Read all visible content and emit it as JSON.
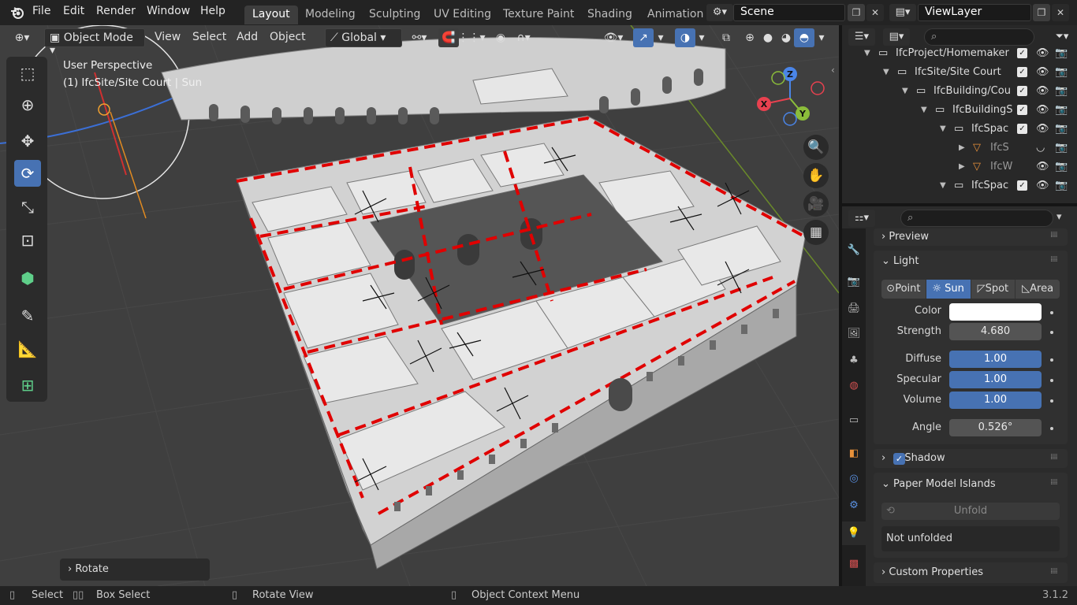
{
  "menubar": {
    "items": [
      "File",
      "Edit",
      "Render",
      "Window",
      "Help"
    ],
    "workspaces": [
      "Layout",
      "Modeling",
      "Sculpting",
      "UV Editing",
      "Texture Paint",
      "Shading",
      "Animation"
    ],
    "active_workspace": "Layout",
    "scene": "Scene",
    "view_layer": "ViewLayer"
  },
  "viewport_header": {
    "mode": "Object Mode",
    "menus": [
      "View",
      "Select",
      "Add",
      "Object"
    ],
    "orientation": "Global"
  },
  "viewport": {
    "perspective_label": "User Perspective",
    "object_label": "(1) IfcSite/Site Court | Sun",
    "last_operator": "Rotate",
    "gizmo_axes": [
      "X",
      "Y",
      "Z"
    ]
  },
  "outliner": {
    "rows": [
      {
        "label": "IfcProject/Homemaker",
        "indent": 0
      },
      {
        "label": "IfcSite/Site Court",
        "indent": 1
      },
      {
        "label": "IfcBuilding/Cou",
        "indent": 2
      },
      {
        "label": "IfcBuildingS",
        "indent": 3
      },
      {
        "label": "IfcSpac",
        "indent": 4
      },
      {
        "label": "IfcS",
        "indent": 5
      },
      {
        "label": "IfcW",
        "indent": 5
      },
      {
        "label": "IfcSpac",
        "indent": 4
      }
    ]
  },
  "properties": {
    "preview_label": "Preview",
    "light_label": "Light",
    "light_types": [
      "Point",
      "Sun",
      "Spot",
      "Area"
    ],
    "active_light_type": "Sun",
    "color_label": "Color",
    "strength_label": "Strength",
    "strength": "4.680",
    "diffuse_label": "Diffuse",
    "diffuse": "1.00",
    "specular_label": "Specular",
    "specular": "1.00",
    "volume_label": "Volume",
    "volume": "1.00",
    "angle_label": "Angle",
    "angle": "0.526°",
    "shadow_label": "Shadow",
    "paper_label": "Paper Model Islands",
    "unfold_label": "Unfold",
    "unfold_status": "Not unfolded",
    "custom_label": "Custom Properties"
  },
  "statusbar": {
    "select": "Select",
    "box_select": "Box Select",
    "rotate_view": "Rotate View",
    "context_menu": "Object Context Menu",
    "version": "3.1.2"
  },
  "colors": {
    "accent": "#4772b3",
    "red_edges": "#e00000",
    "x_axis": "#e8414f",
    "y_axis": "#8bbd3a",
    "z_axis": "#4a85e8"
  }
}
